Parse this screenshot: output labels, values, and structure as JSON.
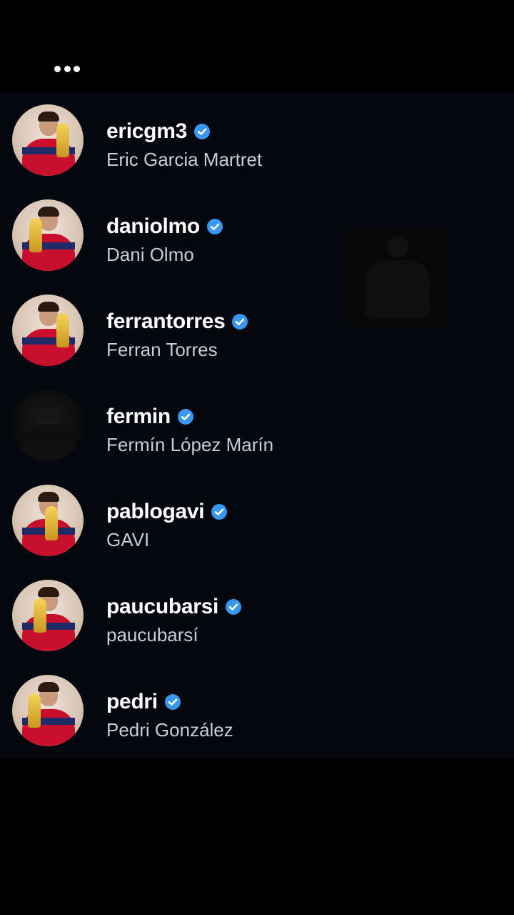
{
  "theme": {
    "background": "#000000",
    "panel": "#05070f",
    "verified_color": "#3897f0"
  },
  "header": {
    "more_icon": "more-horizontal-icon"
  },
  "accounts": [
    {
      "username": "ericgm3",
      "full_name": "Eric Garcia Martret",
      "verified": true
    },
    {
      "username": "daniolmo",
      "full_name": "Dani Olmo",
      "verified": true
    },
    {
      "username": "ferrantorres",
      "full_name": "Ferran Torres",
      "verified": true
    },
    {
      "username": "fermin",
      "full_name": "Fermín López Marín",
      "verified": true
    },
    {
      "username": "pablogavi",
      "full_name": "GAVI",
      "verified": true
    },
    {
      "username": "paucubarsi",
      "full_name": "paucubarsí",
      "verified": true
    },
    {
      "username": "pedri",
      "full_name": "Pedri González",
      "verified": true
    }
  ]
}
